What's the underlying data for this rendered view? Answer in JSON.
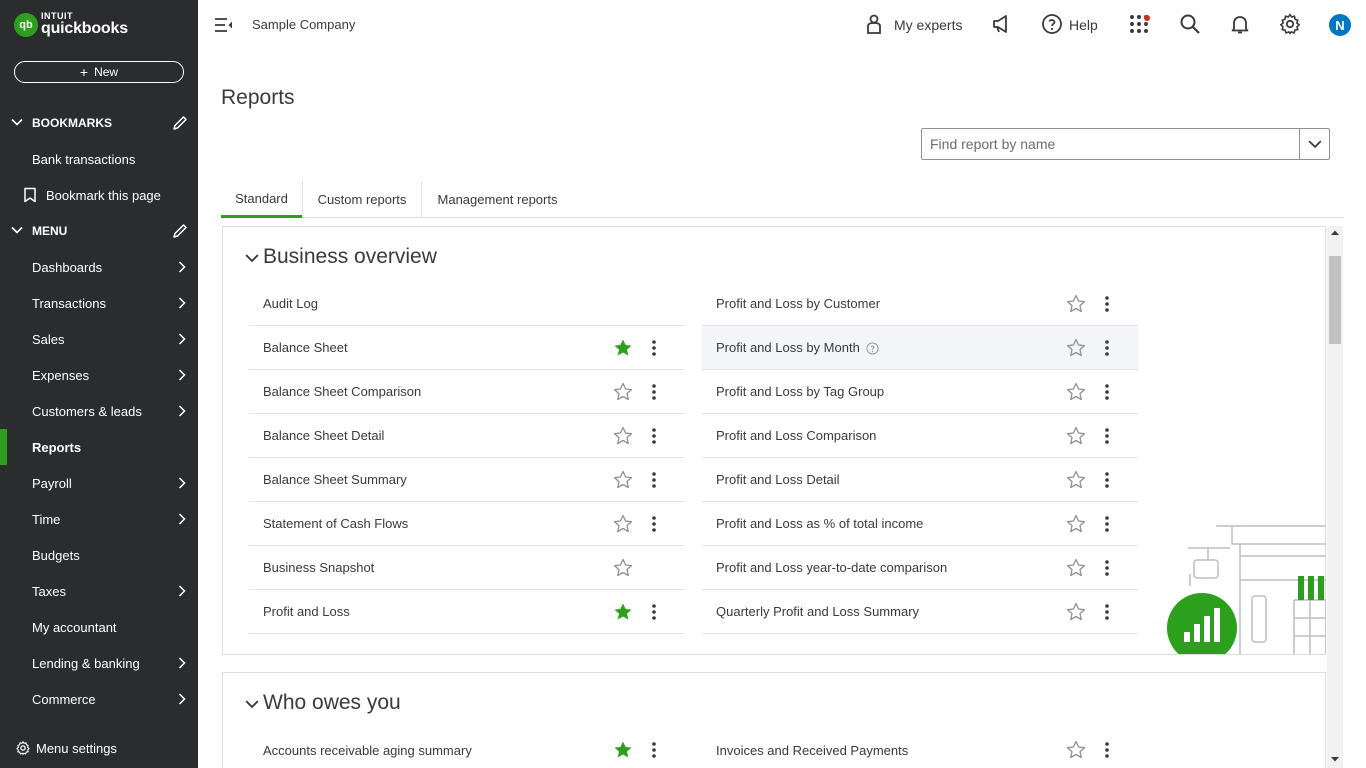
{
  "app": {
    "logo_top": "INTUIT",
    "logo_bottom": "quickbooks",
    "logo_mark": "qb",
    "new_button": "New"
  },
  "sidebar": {
    "bookmarks_header": "BOOKMARKS",
    "bookmark_items": [
      {
        "label": "Bank transactions"
      },
      {
        "label": "Bookmark this page"
      }
    ],
    "menu_header": "MENU",
    "menu_items": [
      {
        "label": "Dashboards",
        "has_arrow": true
      },
      {
        "label": "Transactions",
        "has_arrow": true
      },
      {
        "label": "Sales",
        "has_arrow": true
      },
      {
        "label": "Expenses",
        "has_arrow": true
      },
      {
        "label": "Customers & leads",
        "has_arrow": true
      },
      {
        "label": "Reports",
        "has_arrow": false,
        "active": true
      },
      {
        "label": "Payroll",
        "has_arrow": true
      },
      {
        "label": "Time",
        "has_arrow": true
      },
      {
        "label": "Budgets",
        "has_arrow": false
      },
      {
        "label": "Taxes",
        "has_arrow": true
      },
      {
        "label": "My accountant",
        "has_arrow": false
      },
      {
        "label": "Lending & banking",
        "has_arrow": true
      },
      {
        "label": "Commerce",
        "has_arrow": true
      }
    ],
    "menu_settings": "Menu settings"
  },
  "topbar": {
    "company": "Sample Company",
    "my_experts": "My experts",
    "help": "Help",
    "avatar_initial": "N"
  },
  "page": {
    "title": "Reports",
    "search_placeholder": "Find report by name",
    "tabs": [
      {
        "label": "Standard",
        "active": true
      },
      {
        "label": "Custom reports",
        "active": false
      },
      {
        "label": "Management reports",
        "active": false
      }
    ]
  },
  "sections": {
    "business_overview": {
      "title": "Business overview",
      "left": [
        {
          "name": "Audit Log",
          "star": "none",
          "menu": false
        },
        {
          "name": "Balance Sheet",
          "star": "filled",
          "menu": true
        },
        {
          "name": "Balance Sheet Comparison",
          "star": "outline",
          "menu": true
        },
        {
          "name": "Balance Sheet Detail",
          "star": "outline",
          "menu": true
        },
        {
          "name": "Balance Sheet Summary",
          "star": "outline",
          "menu": true
        },
        {
          "name": "Statement of Cash Flows",
          "star": "outline",
          "menu": true
        },
        {
          "name": "Business Snapshot",
          "star": "outline",
          "menu": false
        },
        {
          "name": "Profit and Loss",
          "star": "filled",
          "menu": true
        }
      ],
      "right": [
        {
          "name": "Profit and Loss by Customer",
          "star": "outline",
          "menu": true
        },
        {
          "name": "Profit and Loss by Month",
          "star": "outline",
          "menu": true,
          "help": true,
          "hover": true
        },
        {
          "name": "Profit and Loss by Tag Group",
          "star": "outline",
          "menu": true
        },
        {
          "name": "Profit and Loss Comparison",
          "star": "outline",
          "menu": true
        },
        {
          "name": "Profit and Loss Detail",
          "star": "outline",
          "menu": true
        },
        {
          "name": "Profit and Loss as % of total income",
          "star": "outline",
          "menu": true
        },
        {
          "name": "Profit and Loss year-to-date comparison",
          "star": "outline",
          "menu": true
        },
        {
          "name": "Quarterly Profit and Loss Summary",
          "star": "outline",
          "menu": true
        }
      ]
    },
    "who_owes_you": {
      "title": "Who owes you",
      "left": [
        {
          "name": "Accounts receivable aging summary",
          "star": "filled",
          "menu": true
        }
      ],
      "right": [
        {
          "name": "Invoices and Received Payments",
          "star": "outline",
          "menu": true
        }
      ]
    }
  },
  "colors": {
    "sidebar_bg": "#2b2c2e",
    "brand_green": "#2ca01c",
    "avatar_blue": "#0077c5",
    "star_outline": "#8d9096"
  }
}
